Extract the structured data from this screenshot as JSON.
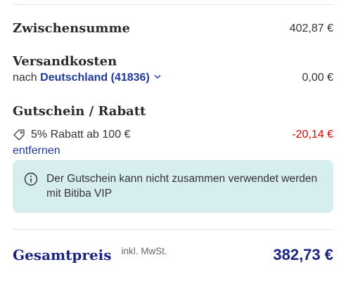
{
  "subtotal": {
    "label": "Zwischensumme",
    "value": "402,87 €"
  },
  "shipping": {
    "label": "Versandkosten",
    "prefix": "nach",
    "destination": "Deutschland (41836)",
    "value": "0,00 €"
  },
  "coupon": {
    "label": "Gutschein / Rabatt",
    "name": "5% Rabatt ab 100 €",
    "value": "-20,14 €",
    "remove_label": "entfernen",
    "icon": "tag-icon"
  },
  "info": {
    "icon": "info-icon",
    "text": "Der Gutschein kann nicht zusammen verwendet werden mit Bitiba VIP"
  },
  "total": {
    "label": "Gesamtpreis",
    "note": "inkl. MwSt.",
    "value": "382,73 €"
  },
  "colors": {
    "accent": "#1a2580",
    "discount": "#e00000",
    "info_bg": "#d6eef0"
  }
}
